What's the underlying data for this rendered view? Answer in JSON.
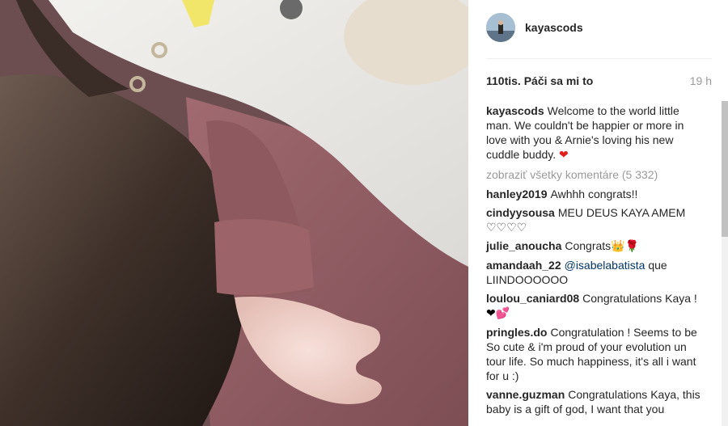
{
  "post": {
    "username": "kayascods",
    "likes": "110tis. Páči sa mi to",
    "time": "19 h",
    "caption": {
      "user": "kayascods",
      "text": "Welcome to the world little man. We couldn't be happier or more in love with you & Arnie's loving his new cuddle buddy.",
      "emoji": "❤"
    },
    "view_all": "zobraziť všetky komentáre (5 332)"
  },
  "comments": [
    {
      "user": "hanley2019",
      "text": "Awhhh congrats!!"
    },
    {
      "user": "cindyysousa",
      "text": "MEU DEUS KAYA AMEM ♡♡♡♡"
    },
    {
      "user": "julie_anoucha",
      "text": "Congrats",
      "emoji": "👑🌹"
    },
    {
      "user": "amandaah_22",
      "mention": "@isabelabatista",
      "text": "que LIINDOOOOOO"
    },
    {
      "user": "loulou_caniard08",
      "text": "Congratulations Kaya !",
      "emoji": "❤💕"
    },
    {
      "user": "pringles.do",
      "text": "Congratulation ! Seems to be So cute & i'm proud of your evolution un tour life. So much happiness, it's all i want for u :)"
    },
    {
      "user": "vanne.guzman",
      "text": "Congratulations Kaya, this baby is a gift of god, I want that you"
    }
  ]
}
